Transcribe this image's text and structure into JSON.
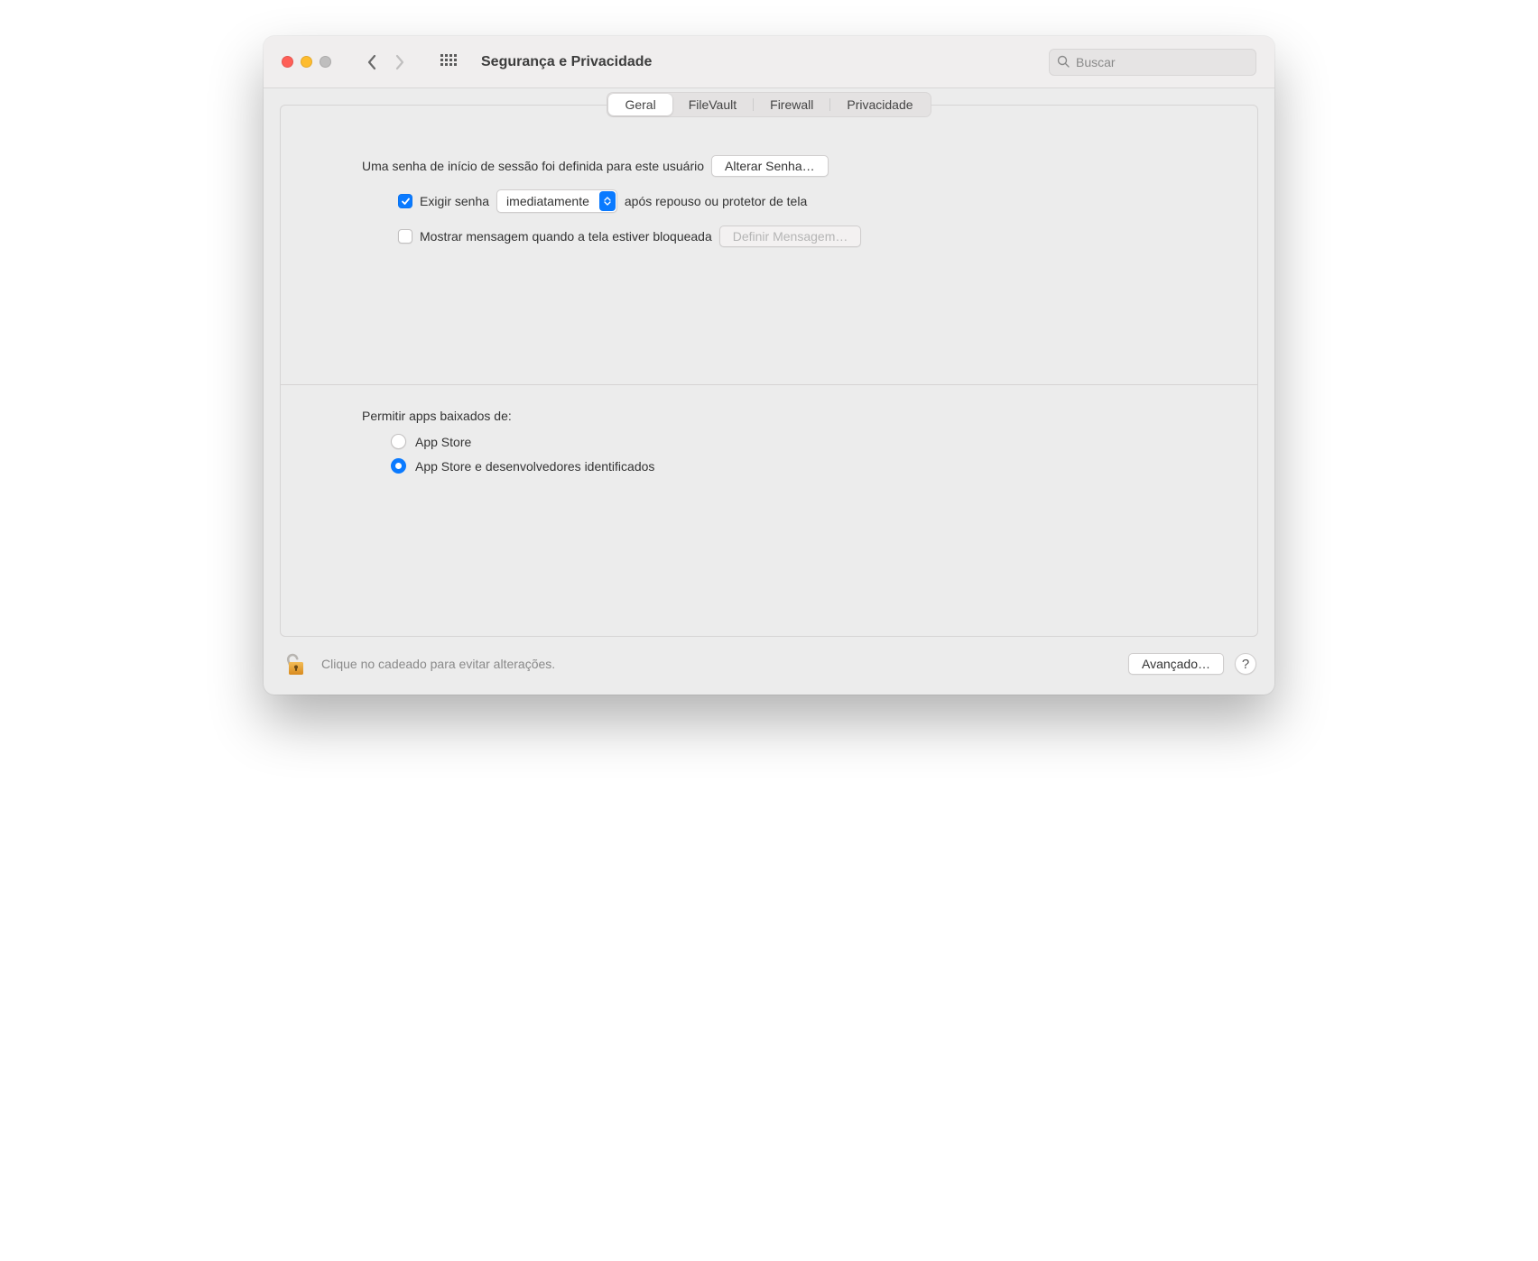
{
  "titlebar": {
    "title": "Segurança e Privacidade",
    "search_placeholder": "Buscar"
  },
  "tabs": {
    "items": [
      "Geral",
      "FileVault",
      "Firewall",
      "Privacidade"
    ],
    "active": 0
  },
  "general": {
    "password_set_text": "Uma senha de início de sessão foi definida para este usuário",
    "change_password_btn": "Alterar Senha…",
    "require_password_label": "Exigir senha",
    "require_password_select": "imediatamente",
    "require_password_suffix": "após repouso ou protetor de tela",
    "require_password_checked": true,
    "show_message_label": "Mostrar mensagem quando a tela estiver bloqueada",
    "show_message_checked": false,
    "set_message_btn": "Definir Mensagem…",
    "allow_apps_label": "Permitir apps baixados de:",
    "radio_options": [
      {
        "label": "App Store",
        "checked": false
      },
      {
        "label": "App Store e desenvolvedores identificados",
        "checked": true
      }
    ]
  },
  "footer": {
    "lock_text": "Clique no cadeado para evitar alterações.",
    "advanced_btn": "Avançado…",
    "help_btn": "?"
  }
}
